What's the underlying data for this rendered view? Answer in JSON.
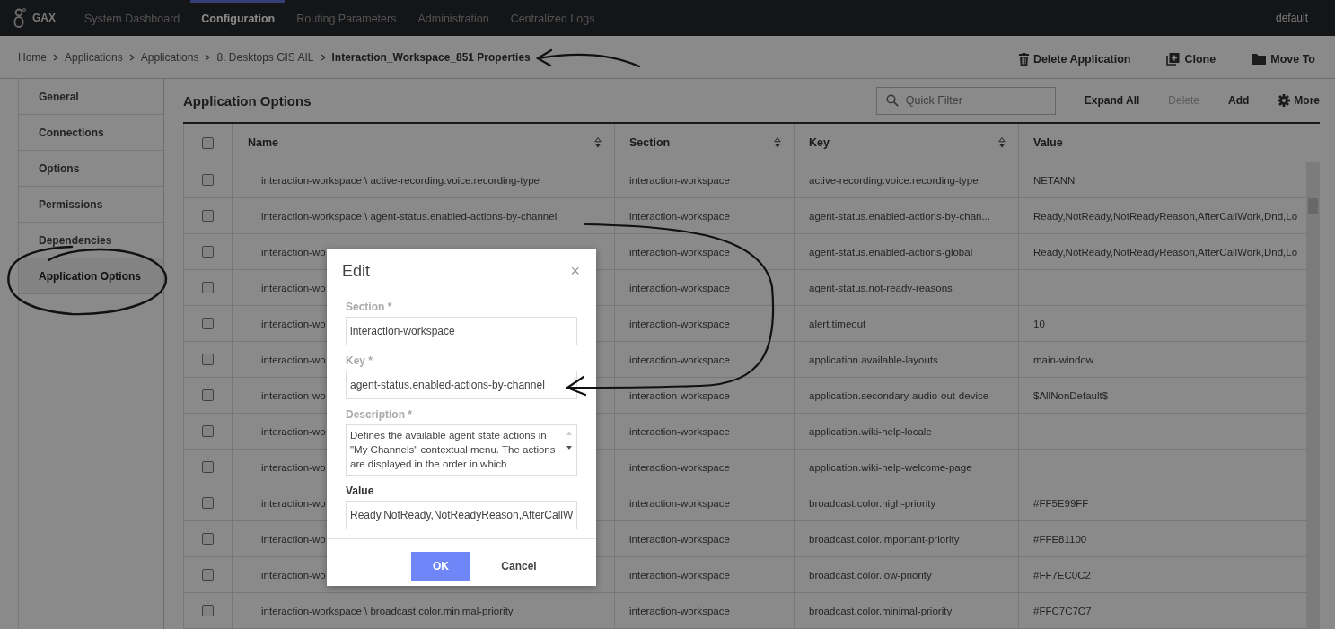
{
  "nav": {
    "logo": "GAX",
    "items": [
      {
        "label": "System Dashboard",
        "selected": false
      },
      {
        "label": "Configuration",
        "selected": true
      },
      {
        "label": "Routing Parameters",
        "selected": false
      },
      {
        "label": "Administration",
        "selected": false
      },
      {
        "label": "Centralized Logs",
        "selected": false
      }
    ],
    "user": "default"
  },
  "breadcrumb": {
    "links": [
      "Home",
      "Applications",
      "Applications",
      "8. Desktops GIS AIL"
    ],
    "current": "Interaction_Workspace_851 Properties"
  },
  "actions": [
    {
      "label": "Delete Application",
      "kind": "delete"
    },
    {
      "label": "Clone",
      "kind": "clone"
    },
    {
      "label": "Move To",
      "kind": "move"
    }
  ],
  "sidebar": {
    "items": [
      {
        "label": "General",
        "selected": false
      },
      {
        "label": "Connections",
        "selected": false
      },
      {
        "label": "Options",
        "selected": false
      },
      {
        "label": "Permissions",
        "selected": false
      },
      {
        "label": "Dependencies",
        "selected": false
      },
      {
        "label": "Application Options",
        "selected": true
      }
    ]
  },
  "panel": {
    "title": "Application Options",
    "filter": {
      "placeholder": "Quick Filter"
    },
    "toolbar": [
      {
        "label": "Expand All",
        "disabled": false,
        "kind": "text"
      },
      {
        "label": "Delete",
        "disabled": true,
        "kind": "text"
      },
      {
        "label": "Add",
        "disabled": false,
        "kind": "text"
      },
      {
        "label": "More",
        "disabled": false,
        "kind": "gear"
      }
    ]
  },
  "table": {
    "header_checked": false,
    "columns": [
      {
        "label": "Name",
        "sortable": true
      },
      {
        "label": "Section",
        "sortable": true
      },
      {
        "label": "Key",
        "sortable": true
      },
      {
        "label": "Value",
        "sortable": false
      }
    ],
    "rows": [
      {
        "checked": false,
        "name": "interaction-workspace \\ active-recording.voice.recording-type",
        "section": "interaction-workspace",
        "key": "active-recording.voice.recording-type",
        "value": "NETANN"
      },
      {
        "checked": false,
        "name": "interaction-workspace \\ agent-status.enabled-actions-by-channel",
        "section": "interaction-workspace",
        "key": "agent-status.enabled-actions-by-chan...",
        "value": "Ready,NotReady,NotReadyReason,AfterCallWork,Dnd,Lo"
      },
      {
        "checked": false,
        "name": "interaction-wo",
        "section": "interaction-workspace",
        "key": "agent-status.enabled-actions-global",
        "value": "Ready,NotReady,NotReadyReason,AfterCallWork,Dnd,Lo"
      },
      {
        "checked": false,
        "name": "interaction-wo",
        "section": "interaction-workspace",
        "key": "agent-status.not-ready-reasons"
      },
      {
        "checked": false,
        "name": "interaction-wo",
        "section": "interaction-workspace",
        "key": "alert.timeout",
        "value": "10"
      },
      {
        "checked": false,
        "name": "interaction-wo",
        "section": "interaction-workspace",
        "key": "application.available-layouts",
        "value": "main-window"
      },
      {
        "checked": false,
        "name": "interaction-wo",
        "section": "interaction-workspace",
        "key": "application.secondary-audio-out-device",
        "value": "$AllNonDefault$"
      },
      {
        "checked": false,
        "name": "interaction-wo",
        "section": "interaction-workspace",
        "key": "application.wiki-help-locale"
      },
      {
        "checked": false,
        "name": "interaction-wo",
        "section": "interaction-workspace",
        "key": "application.wiki-help-welcome-page"
      },
      {
        "checked": false,
        "name": "interaction-wo",
        "section": "interaction-workspace",
        "key": "broadcast.color.high-priority",
        "value": "#FF5E99FF"
      },
      {
        "checked": false,
        "name": "interaction-wo",
        "section": "interaction-workspace",
        "key": "broadcast.color.important-priority",
        "value": "#FFE81100"
      },
      {
        "checked": false,
        "name": "interaction-wo",
        "section": "interaction-workspace",
        "key": "broadcast.color.low-priority",
        "value": "#FF7EC0C2"
      },
      {
        "checked": false,
        "name": "interaction-workspace \\ broadcast.color.minimal-priority",
        "section": "interaction-workspace",
        "key": "broadcast.color.minimal-priority",
        "value": "#FFC7C7C7"
      }
    ]
  },
  "dialog": {
    "title": "Edit",
    "close": "×",
    "fields": [
      {
        "label": "Section *",
        "kind": "input",
        "disabled": true,
        "value": "interaction-workspace"
      },
      {
        "label": "Key *",
        "kind": "input",
        "disabled": true,
        "value": "agent-status.enabled-actions-by-channel"
      },
      {
        "label": "Description *",
        "kind": "textarea",
        "disabled": true,
        "value": "Defines the available agent state actions in \"My Channels\" contextual menu. The actions are displayed in the order in which"
      },
      {
        "label": "Value",
        "kind": "input",
        "disabled": false,
        "value": "Ready,NotReady,NotReadyReason,AfterCallW"
      }
    ],
    "buttons": [
      {
        "label": "OK",
        "kind": "primary"
      },
      {
        "label": "Cancel",
        "kind": "secondary"
      }
    ]
  }
}
